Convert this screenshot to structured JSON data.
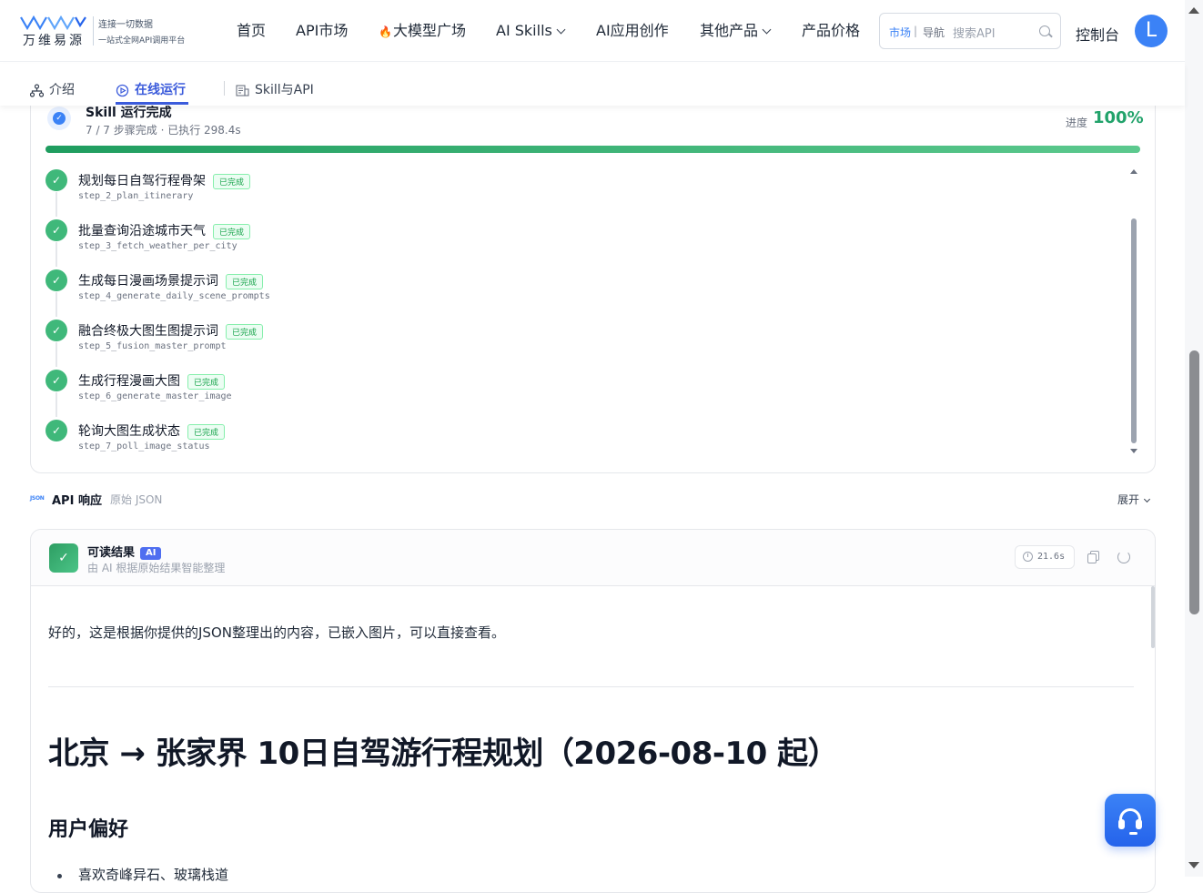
{
  "brand": {
    "name": "万维易源",
    "tagline1": "连接一切数据",
    "tagline2": "一站式全网API调用平台"
  },
  "nav": {
    "home": "首页",
    "api_market": "API市场",
    "llm_square": "大模型广场",
    "ai_skills": "AI Skills",
    "ai_apps": "AI应用创作",
    "other_products": "其他产品",
    "pricing": "产品价格",
    "console": "控制台",
    "avatar_letter": "L"
  },
  "search": {
    "tag_market": "市场",
    "separator": "|",
    "tag_nav": "导航",
    "placeholder": "搜索API"
  },
  "tabs": [
    {
      "label": "介绍",
      "icon": "hierarchy-icon"
    },
    {
      "label": "在线运行",
      "icon": "play-circle-icon",
      "active": true
    },
    {
      "label": "Skill与API",
      "icon": "api-doc-icon"
    }
  ],
  "run": {
    "title": "Skill 运行完成",
    "subtitle": "7 / 7 步骤完成 · 已执行 298.4s",
    "progress_label": "进度",
    "progress_value": "100%",
    "progress_fraction": 1.0,
    "steps": [
      {
        "name": "规划每日自驾行程骨架",
        "status": "已完成",
        "code": "step_2_plan_itinerary"
      },
      {
        "name": "批量查询沿途城市天气",
        "status": "已完成",
        "code": "step_3_fetch_weather_per_city"
      },
      {
        "name": "生成每日漫画场景提示词",
        "status": "已完成",
        "code": "step_4_generate_daily_scene_prompts"
      },
      {
        "name": "融合终极大图生图提示词",
        "status": "已完成",
        "code": "step_5_fusion_master_prompt"
      },
      {
        "name": "生成行程漫画大图",
        "status": "已完成",
        "code": "step_6_generate_master_image"
      },
      {
        "name": "轮询大图生成状态",
        "status": "已完成",
        "code": "step_7_poll_image_status"
      }
    ]
  },
  "api": {
    "icon_text": "JSON",
    "title": "API 响应",
    "subtitle": "原始 JSON",
    "expand": "展开"
  },
  "result": {
    "title": "可读结果",
    "ai_badge": "AI",
    "subtitle": "由 AI 根据原始结果智能整理",
    "time": "21.6s",
    "intro": "好的，这是根据你提供的JSON整理出的内容，已嵌入图片，可以直接查看。",
    "heading": "北京 → 张家界 10日自驾游行程规划（2026-08-10 起）",
    "section": "用户偏好",
    "first_item": "喜欢奇峰异石、玻璃栈道"
  }
}
